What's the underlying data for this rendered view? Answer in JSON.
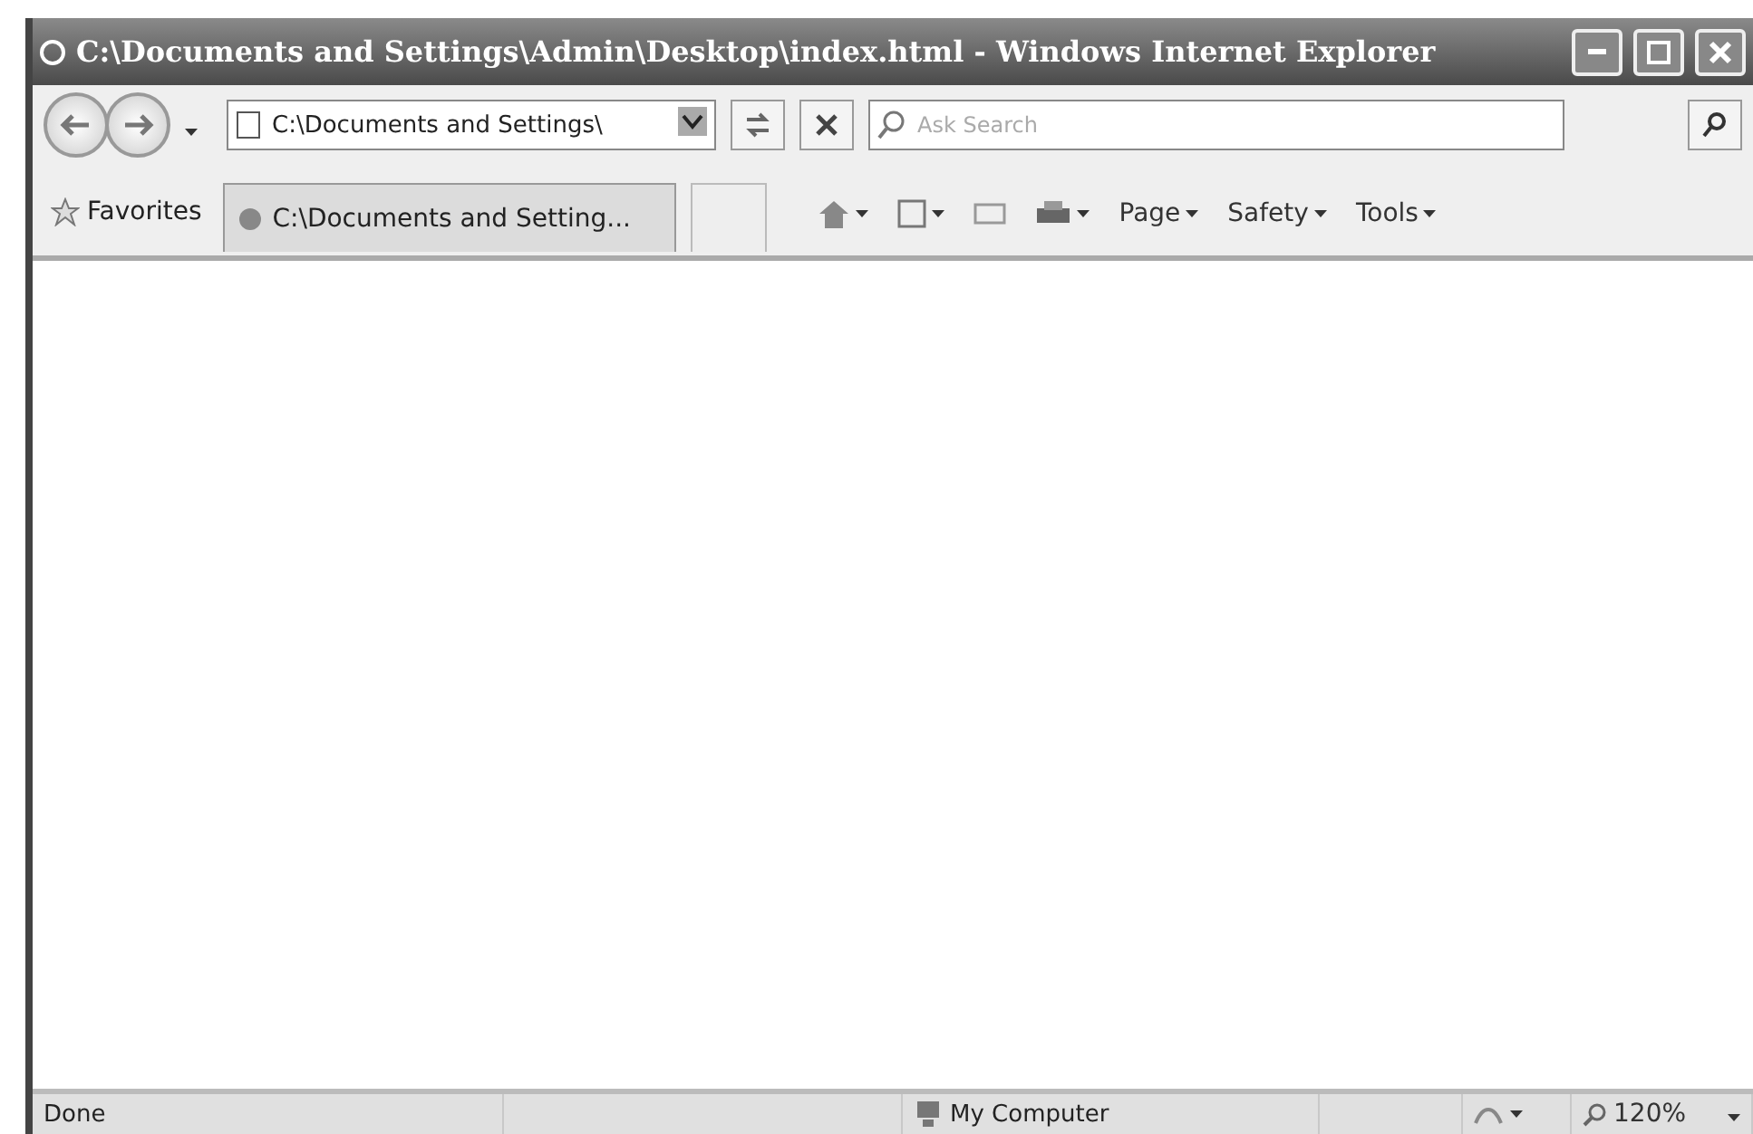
{
  "window": {
    "title": "C:\\Documents and Settings\\Admin\\Desktop\\index.html - Windows Internet Explorer"
  },
  "address_bar": {
    "value": "C:\\Documents and Settings\\"
  },
  "search": {
    "placeholder": "Ask Search"
  },
  "favorites": {
    "label": "Favorites"
  },
  "tabs": [
    {
      "label": "C:\\Documents and Setting...",
      "selected": true
    }
  ],
  "command_bar": [
    {
      "label": "Page"
    },
    {
      "label": "Safety"
    },
    {
      "label": "Tools"
    }
  ],
  "status_bar": {
    "status": "Done",
    "zone": "My Computer",
    "zoom": "120%"
  }
}
